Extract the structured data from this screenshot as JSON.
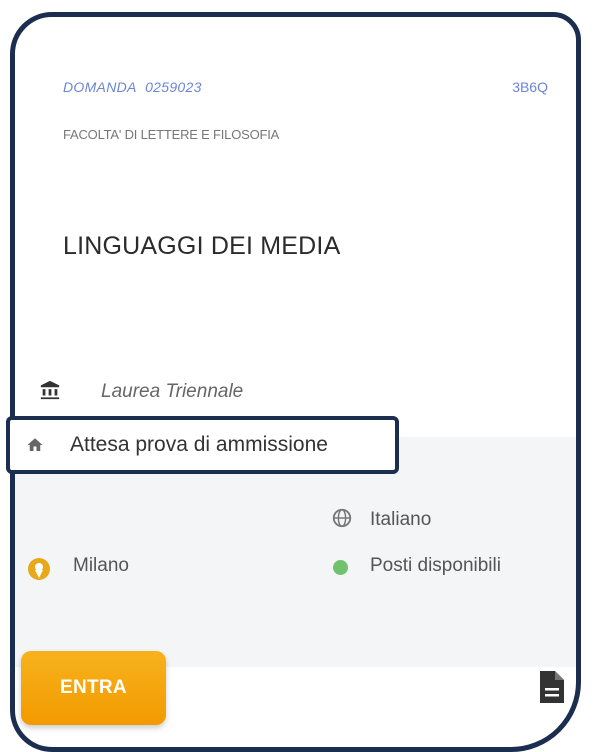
{
  "application": {
    "label": "DOMANDA",
    "number": "0259023",
    "code": "3B6Q"
  },
  "faculty": "FACOLTA' DI LETTERE E FILOSOFIA",
  "course": "LINGUAGGI DEI MEDIA",
  "degree": "Laurea  Triennale",
  "status": "Attesa prova di ammissione",
  "language": "Italiano",
  "city": "Milano",
  "availability": "Posti disponibili",
  "enter_label": "ENTRA",
  "icons": {
    "degree": "university-icon",
    "status": "home-icon",
    "language": "globe-icon",
    "city": "location-pin-icon",
    "availability": "status-dot-icon",
    "document": "document-icon"
  },
  "colors": {
    "accent": "#f5a300",
    "border": "#1c2e4f",
    "link": "#6b86d6",
    "available": "#6fc36f"
  }
}
